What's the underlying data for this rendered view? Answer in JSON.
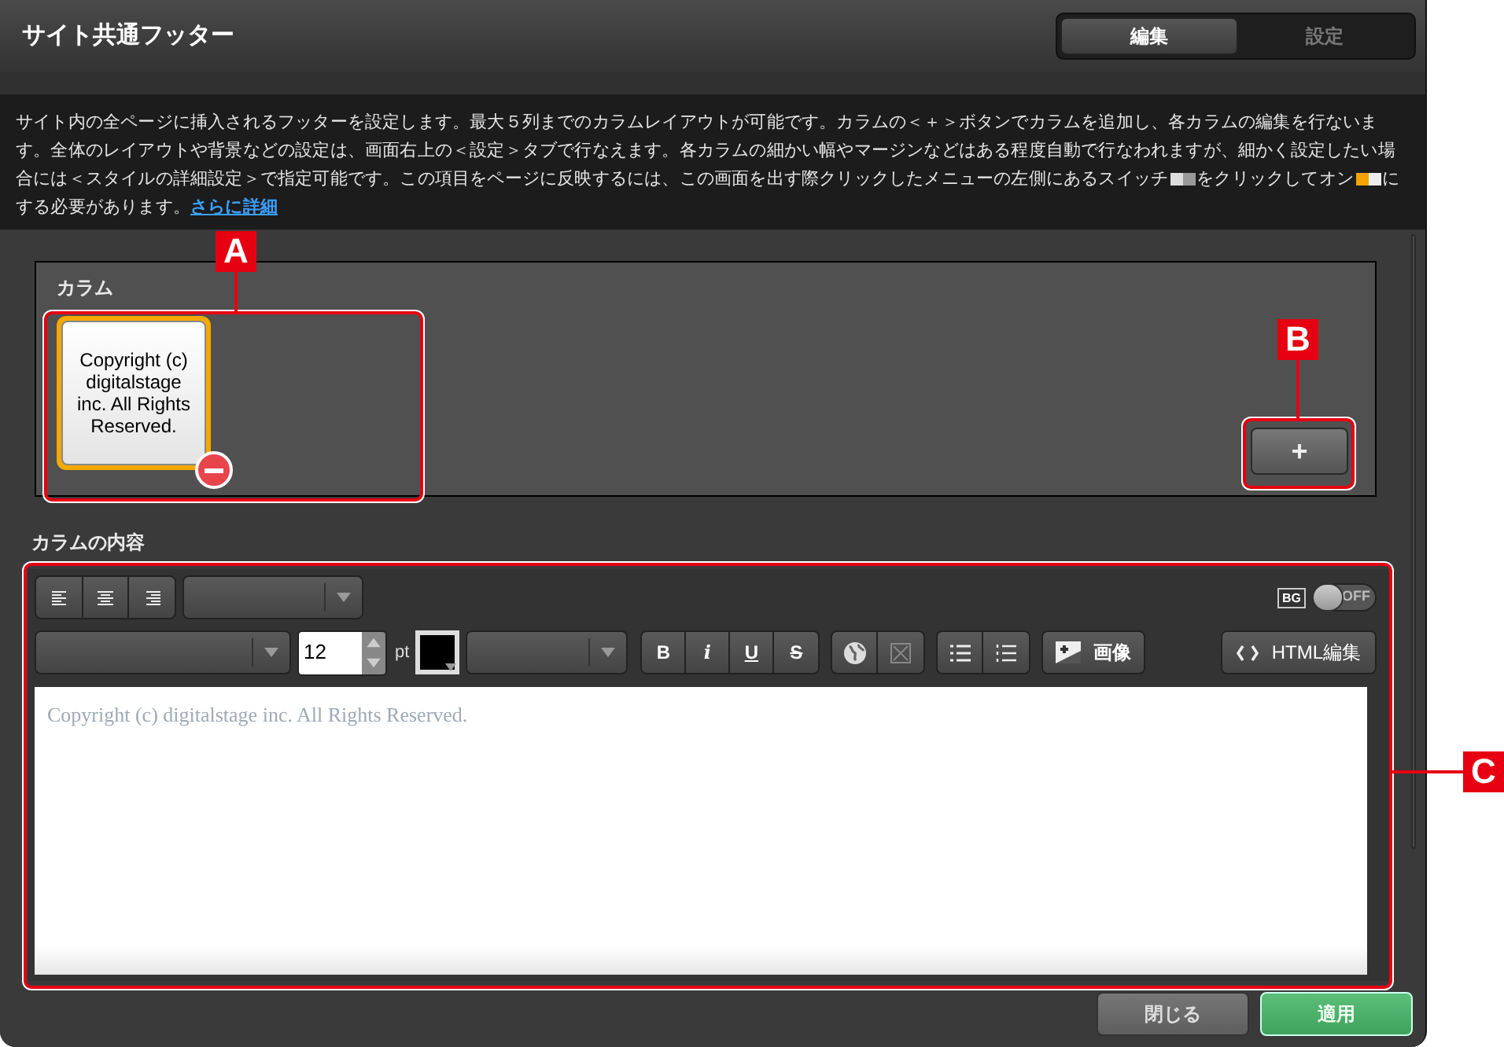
{
  "dialog": {
    "title": "サイト共通フッター",
    "tabs": [
      {
        "label": "編集",
        "selected": true
      },
      {
        "label": "設定",
        "selected": false
      }
    ]
  },
  "description": {
    "parts": [
      {
        "kind": "text",
        "text": "サイト内の全ページに挿入されるフッターを設定します。最大５列までのカラムレイアウトが可能です。カラムの＜＋＞ボタンでカラムを追加し、各カラムの編集を行ないます。全体のレイアウトや背景などの設定は、画面右上の＜設定＞タブで行なえます。各カラムの細かい幅やマージンなどはある程度自動で行なわれますが、細かく設定したい場合には＜スタイルの詳細設定＞で指定可能です。この項目をページに反映するには、この画面を出す際クリックしたメニューの左側にあるスイッチ"
      },
      {
        "kind": "switch_off"
      },
      {
        "kind": "text",
        "text": "をクリックしてオン"
      },
      {
        "kind": "switch_on"
      },
      {
        "kind": "text",
        "text": "にする必要があります。"
      },
      {
        "kind": "link",
        "text": "さらに詳細"
      }
    ]
  },
  "columns": {
    "label": "カラム",
    "items": [
      {
        "text": "Copyright (c) digitalstage inc. All Rights Reserved.",
        "selected": true
      }
    ],
    "add_button": "+"
  },
  "content": {
    "label": "カラムの内容",
    "toolbar": {
      "bg_toggle": {
        "label": "BG",
        "state": "OFF",
        "on": false
      },
      "font_size": "12",
      "unit": "pt",
      "swatch": {
        "color": "#000000"
      },
      "format_buttons": [
        {
          "label": "B"
        },
        {
          "label": "i"
        },
        {
          "label": "U"
        },
        {
          "label": "S"
        }
      ],
      "image_button": "画像",
      "html_button": "HTML編集"
    },
    "editor_text": "Copyright (c) digitalstage inc. All Rights Reserved."
  },
  "footer_buttons": [
    {
      "label": "閉じる",
      "kind": "secondary"
    },
    {
      "label": "適用",
      "kind": "primary"
    }
  ],
  "callouts": [
    {
      "label": "A"
    },
    {
      "label": "B"
    },
    {
      "label": "C"
    }
  ]
}
